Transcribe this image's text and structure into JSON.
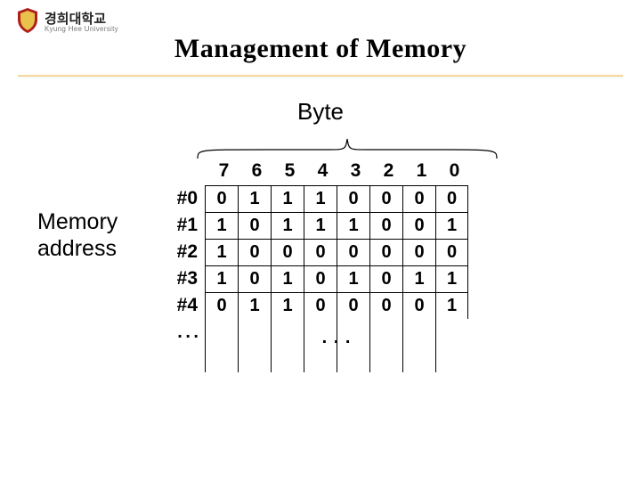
{
  "logo": {
    "korean": "경희대학교",
    "english": "Kyung Hee University"
  },
  "title": "Management of Memory",
  "labels": {
    "byte": "Byte",
    "memory_address": "Memory\naddress"
  },
  "chart_data": {
    "type": "table",
    "title": "Byte layout of memory",
    "bit_columns": [
      "7",
      "6",
      "5",
      "4",
      "3",
      "2",
      "1",
      "0"
    ],
    "row_labels": [
      "#0",
      "#1",
      "#2",
      "#3",
      "#4"
    ],
    "rows": [
      [
        "0",
        "1",
        "1",
        "1",
        "0",
        "0",
        "0",
        "0"
      ],
      [
        "1",
        "0",
        "1",
        "1",
        "1",
        "0",
        "0",
        "1"
      ],
      [
        "1",
        "0",
        "0",
        "0",
        "0",
        "0",
        "0",
        "0"
      ],
      [
        "1",
        "0",
        "1",
        "0",
        "1",
        "0",
        "1",
        "1"
      ],
      [
        "0",
        "1",
        "1",
        "0",
        "0",
        "0",
        "0",
        "1"
      ]
    ],
    "row_ellipsis": ". . .",
    "cell_ellipsis": ". . ."
  }
}
